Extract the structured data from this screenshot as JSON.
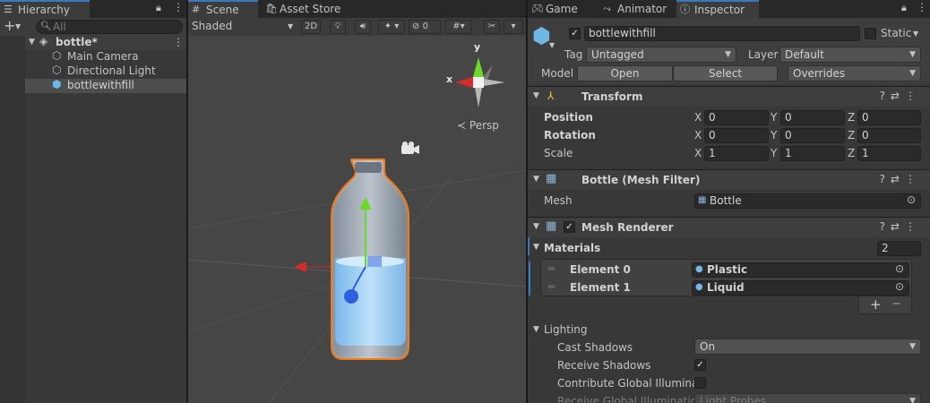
{
  "hierarchy": {
    "tab_label": "Hierarchy",
    "search_placeholder": "All",
    "add_symbol": "+",
    "scene_name": "bottle*",
    "items": [
      "Main Camera",
      "Directional Light",
      "bottlewithfill"
    ]
  },
  "scene": {
    "tabs": [
      "Scene",
      "Asset Store"
    ],
    "shading_mode": "Shaded",
    "mode_2d": "2D",
    "hidden_count": "0",
    "gizmo_axes": {
      "x": "x",
      "y": "y"
    },
    "projection_label": "Persp"
  },
  "inspector": {
    "tabs": [
      "Game",
      "Animator",
      "Inspector"
    ],
    "object_name": "bottlewithfill",
    "static_label": "Static",
    "tag_label": "Tag",
    "tag_value": "Untagged",
    "layer_label": "Layer",
    "layer_value": "Default",
    "model_label": "Model",
    "open_button": "Open",
    "select_button": "Select",
    "overrides_value": "Overrides",
    "transform": {
      "title": "Transform",
      "rows": [
        {
          "label": "Position",
          "x": "0",
          "y": "0",
          "z": "0"
        },
        {
          "label": "Rotation",
          "x": "0",
          "y": "0",
          "z": "0"
        },
        {
          "label": "Scale",
          "x": "1",
          "y": "1",
          "z": "1"
        }
      ],
      "axis_labels": {
        "x": "X",
        "y": "Y",
        "z": "Z"
      }
    },
    "mesh_filter": {
      "title": "Bottle (Mesh Filter)",
      "mesh_label": "Mesh",
      "mesh_value": "Bottle"
    },
    "mesh_renderer": {
      "title": "Mesh Renderer",
      "materials_label": "Materials",
      "materials_count": "2",
      "elements": [
        {
          "label": "Element 0",
          "value": "Plastic"
        },
        {
          "label": "Element 1",
          "value": "Liquid"
        }
      ],
      "add_symbol": "+",
      "remove_symbol": "−",
      "lighting_label": "Lighting",
      "cast_shadows_label": "Cast Shadows",
      "cast_shadows_value": "On",
      "receive_shadows_label": "Receive Shadows",
      "contribute_gi_label": "Contribute Global Illuminati",
      "receive_gi_label": "Receive Global Illumination",
      "receive_gi_value": "Light Probes"
    }
  },
  "colors": {
    "accent_blue": "#3a79bb",
    "selection_outline": "#f07a1e",
    "axis_x": "#d42b2b",
    "axis_y": "#6cd92a",
    "axis_z": "#2e5fe0"
  }
}
